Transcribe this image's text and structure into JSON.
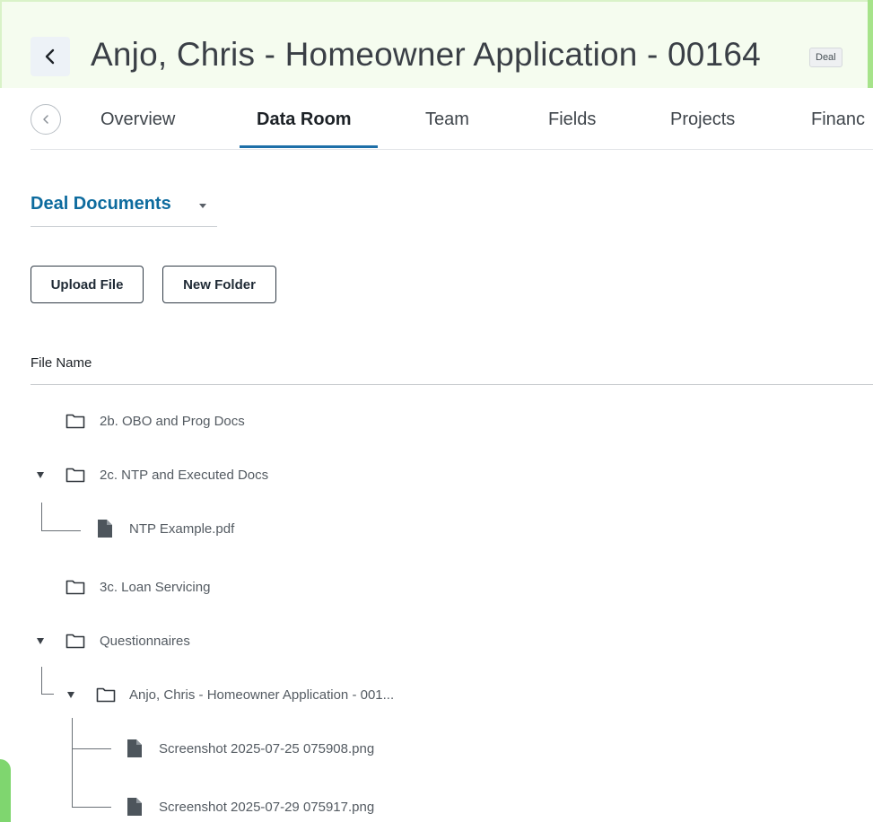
{
  "header": {
    "back_label": "<",
    "title": "Anjo, Chris - Homeowner Application - 00164",
    "badge": "Deal"
  },
  "tabs": [
    {
      "label": "Overview"
    },
    {
      "label": "Data Room",
      "active": true
    },
    {
      "label": "Team"
    },
    {
      "label": "Fields"
    },
    {
      "label": "Projects"
    },
    {
      "label": "Financ"
    }
  ],
  "documents": {
    "selector_label": "Deal Documents",
    "upload_label": "Upload File",
    "new_folder_label": "New Folder",
    "column_header": "File Name"
  },
  "tree": {
    "folder_2b": "2b. OBO and Prog Docs",
    "folder_2c": "2c. NTP and Executed Docs",
    "file_ntp": "NTP Example.pdf",
    "folder_3c": "3c. Loan Servicing",
    "folder_questionnaires": "Questionnaires",
    "folder_anjo": "Anjo, Chris - Homeowner Application - 001...",
    "file_screenshot1": "Screenshot 2025-07-25 075908.png",
    "file_screenshot2": "Screenshot 2025-07-29 075917.png"
  },
  "colors": {
    "accent_blue": "#0d6b9e",
    "active_tab_underline": "#1e6fa8",
    "green_accent": "#7fd66f"
  }
}
